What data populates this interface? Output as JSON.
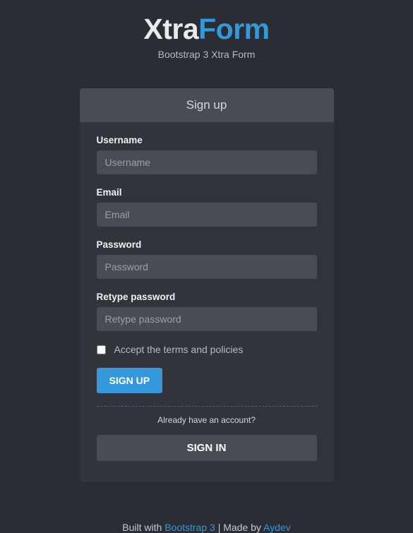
{
  "header": {
    "logo_part1": "Xtra",
    "logo_part2": "Form",
    "subtitle": "Bootstrap 3 Xtra Form"
  },
  "panel": {
    "title": "Sign up",
    "fields": {
      "username": {
        "label": "Username",
        "placeholder": "Username",
        "value": ""
      },
      "email": {
        "label": "Email",
        "placeholder": "Email",
        "value": ""
      },
      "password": {
        "label": "Password",
        "placeholder": "Password",
        "value": ""
      },
      "retype": {
        "label": "Retype password",
        "placeholder": "Retype password",
        "value": ""
      }
    },
    "terms_label": "Accept the terms and policies",
    "submit_label": "Sign up",
    "prompt_text": "Already have an account?",
    "signin_label": "Sign in"
  },
  "footer": {
    "prefix": "Built with ",
    "link1": "Bootstrap 3",
    "mid": " | Made by ",
    "link2": "Aydev"
  }
}
